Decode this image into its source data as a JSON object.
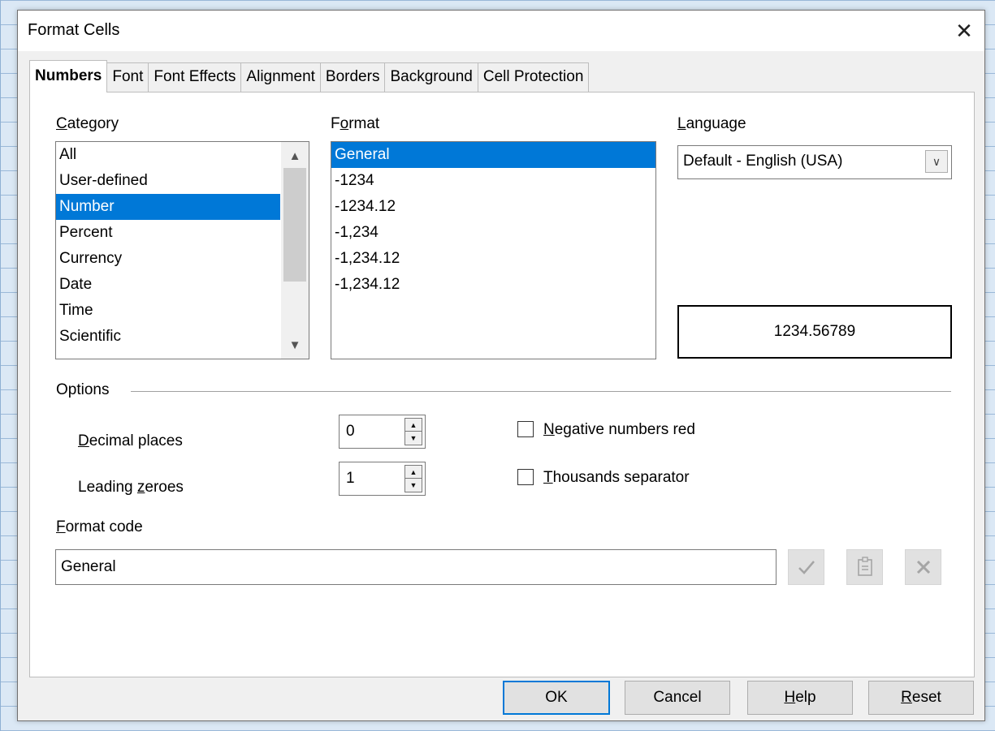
{
  "dialog": {
    "title": "Format Cells",
    "close_glyph": "✕"
  },
  "tabs": [
    {
      "label": "Numbers",
      "active": true
    },
    {
      "label": "Font"
    },
    {
      "label": "Font Effects"
    },
    {
      "label": "Alignment"
    },
    {
      "label": "Borders"
    },
    {
      "label": "Background"
    },
    {
      "label": "Cell Protection"
    }
  ],
  "category": {
    "label_key": "C",
    "label_rest": "ategory",
    "items": [
      "All",
      "User-defined",
      "Number",
      "Percent",
      "Currency",
      "Date",
      "Time",
      "Scientific"
    ],
    "selected": "Number"
  },
  "format": {
    "label_pre": "F",
    "label_key": "o",
    "label_rest": "rmat",
    "items": [
      "General",
      "-1234",
      "-1234.12",
      "-1,234",
      "-1,234.12",
      "-1,234.12"
    ],
    "selected": "General"
  },
  "language": {
    "label_key": "L",
    "label_rest": "anguage",
    "value": "Default - English (USA)"
  },
  "preview": {
    "value": "1234.56789"
  },
  "options": {
    "label": "Options",
    "decimal_places": {
      "label_key": "D",
      "label_rest": "ecimal places",
      "value": "0"
    },
    "leading_zeroes": {
      "label_pre": "Leading ",
      "label_key": "z",
      "label_rest": "eroes",
      "value": "1"
    },
    "negative_red": {
      "label_key": "N",
      "label_rest": "egative numbers red",
      "checked": false
    },
    "thousands_sep": {
      "label_key": "T",
      "label_rest": "housands separator",
      "checked": false
    }
  },
  "format_code": {
    "label_key": "F",
    "label_rest": "ormat code",
    "value": "General"
  },
  "buttons": {
    "ok": "OK",
    "cancel": "Cancel",
    "help_key": "H",
    "help_rest": "elp",
    "reset_key": "R",
    "reset_rest": "eset"
  },
  "icons": {
    "accept": "check-icon",
    "comment": "edit-comment-icon",
    "delete": "delete-icon"
  }
}
